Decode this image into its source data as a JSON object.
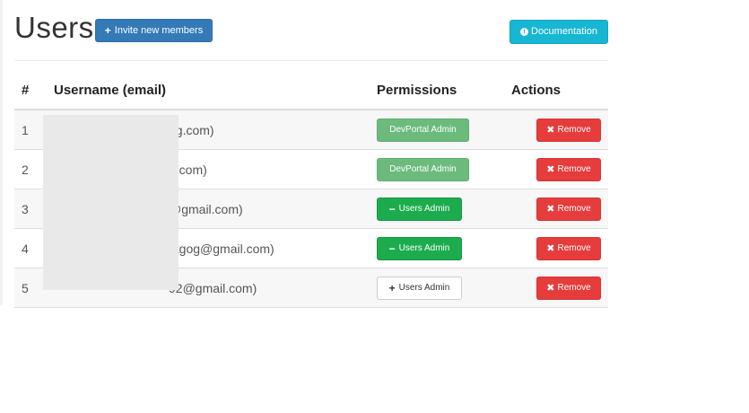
{
  "header": {
    "title": "Users",
    "invite_label": "Invite new members",
    "invite_icon": "+",
    "documentation_label": "Documentation",
    "documentation_icon": "i"
  },
  "table": {
    "headers": [
      "#",
      "Username (email)",
      "Permissions",
      "Actions"
    ],
    "rows": [
      {
        "num": "1",
        "email": "og.com)",
        "permission": "DevPortal Admin",
        "permission_style": "devportal",
        "action": "Remove"
      },
      {
        "num": "2",
        "email": "g.com)",
        "permission": "DevPortal Admin",
        "permission_style": "devportal",
        "action": "Remove"
      },
      {
        "num": "3",
        "email": "@gmail.com)",
        "permission": "Users Admin",
        "permission_style": "active",
        "action": "Remove"
      },
      {
        "num": "4",
        "email": "ntgog@gmail.com)",
        "permission": "Users Admin",
        "permission_style": "active",
        "action": "Remove"
      },
      {
        "num": "5",
        "email": "92@gmail.com)",
        "permission": "Users Admin",
        "permission_style": "inactive",
        "action": "Remove"
      }
    ]
  },
  "icons": {
    "plus": "+",
    "minus": "−",
    "remove": "✖"
  },
  "colors": {
    "primary": "#337ab7",
    "info": "#17b6d3",
    "success": "#1cac4e",
    "success_muted": "#6cbb7d",
    "danger": "#e63c3c"
  }
}
